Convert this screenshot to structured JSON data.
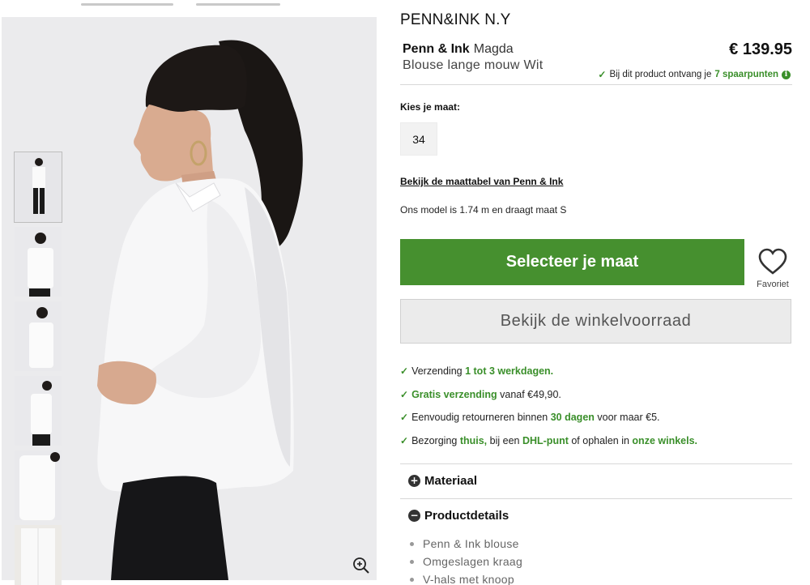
{
  "brand_logo": "PENN&INK N.Y",
  "product": {
    "brand": "Penn & Ink",
    "model": "Magda",
    "subtitle": "Blouse lange mouw Wit",
    "price": "€ 139.95"
  },
  "points": {
    "prefix": "Bij dit product ontvang je",
    "highlight": "7 spaarpunten"
  },
  "size": {
    "label": "Kies je maat:",
    "options": [
      "34"
    ]
  },
  "size_table_link": "Bekijk de maattabel van Penn & Ink",
  "model_info": "Ons model is 1.74 m en draagt maat S",
  "cta_label": "Selecteer je maat",
  "favorite_label": "Favoriet",
  "stock_button_label": "Bekijk de winkelvoorraad",
  "usps": [
    {
      "parts": [
        {
          "t": "Verzending "
        },
        {
          "t": "1 tot 3 werkdagen.",
          "hl": true
        }
      ]
    },
    {
      "parts": [
        {
          "t": "Gratis verzending",
          "hl": true
        },
        {
          "t": " vanaf €49,90."
        }
      ]
    },
    {
      "parts": [
        {
          "t": "Eenvoudig retourneren binnen "
        },
        {
          "t": "30 dagen",
          "hl": true
        },
        {
          "t": " voor maar €5."
        }
      ]
    },
    {
      "parts": [
        {
          "t": "Bezorging "
        },
        {
          "t": "thuis,",
          "hl": true
        },
        {
          "t": " bij een "
        },
        {
          "t": "DHL-punt",
          "hl": true
        },
        {
          "t": " of ophalen in "
        },
        {
          "t": "onze winkels.",
          "hl": true
        }
      ]
    }
  ],
  "accordion": {
    "materiaal": {
      "title": "Materiaal",
      "icon": "plus-circle-icon"
    },
    "productdetails": {
      "title": "Productdetails",
      "icon": "minus-circle-icon"
    }
  },
  "details": [
    "Penn & Ink blouse",
    "Omgeslagen kraag",
    "V-hals met knoop"
  ],
  "colors": {
    "accent_green": "#46902f",
    "text_green": "#3a8f2a",
    "stock_button_bg": "#ebebeb"
  },
  "icons": {
    "check": "check-icon",
    "info": "info-icon",
    "heart": "heart-icon",
    "zoom": "zoom-in-icon"
  }
}
